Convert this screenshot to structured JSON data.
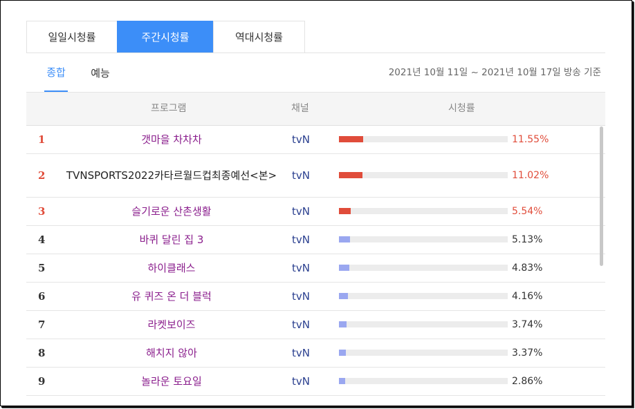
{
  "tabs": [
    {
      "label": "일일시청률",
      "active": false
    },
    {
      "label": "주간시청률",
      "active": true
    },
    {
      "label": "역대시청률",
      "active": false
    }
  ],
  "subtabs": [
    {
      "label": "종합",
      "active": true
    },
    {
      "label": "예능",
      "active": false
    }
  ],
  "period": "2021년 10월 11일 ~ 2021년 10월 17일 방송 기준",
  "columns": {
    "program": "프로그램",
    "channel": "채널",
    "rating": "시청률"
  },
  "rows": [
    {
      "rank": "1",
      "program": "갯마을 차차차",
      "channel": "tvN",
      "rating": "11.55%",
      "value": 11.55
    },
    {
      "rank": "2",
      "program": "TVNSPORTS2022카타르월드컵최종예선<본>",
      "channel": "tvN",
      "rating": "11.02%",
      "value": 11.02
    },
    {
      "rank": "3",
      "program": "슬기로운 산촌생활",
      "channel": "tvN",
      "rating": "5.54%",
      "value": 5.54
    },
    {
      "rank": "4",
      "program": "바퀴 달린 집 3",
      "channel": "tvN",
      "rating": "5.13%",
      "value": 5.13
    },
    {
      "rank": "5",
      "program": "하이클래스",
      "channel": "tvN",
      "rating": "4.83%",
      "value": 4.83
    },
    {
      "rank": "6",
      "program": "유 퀴즈 온 더 블럭",
      "channel": "tvN",
      "rating": "4.16%",
      "value": 4.16
    },
    {
      "rank": "7",
      "program": "라켓보이즈",
      "channel": "tvN",
      "rating": "3.74%",
      "value": 3.74
    },
    {
      "rank": "8",
      "program": "해치지 않아",
      "channel": "tvN",
      "rating": "3.37%",
      "value": 3.37
    },
    {
      "rank": "9",
      "program": "놀라운 토요일",
      "channel": "tvN",
      "rating": "2.86%",
      "value": 2.86
    }
  ],
  "colors": {
    "accent": "#3c8ef8",
    "top_bar": "#e04c3a",
    "bar": "#9aa7f0",
    "program_link": "#8a1d8c"
  }
}
